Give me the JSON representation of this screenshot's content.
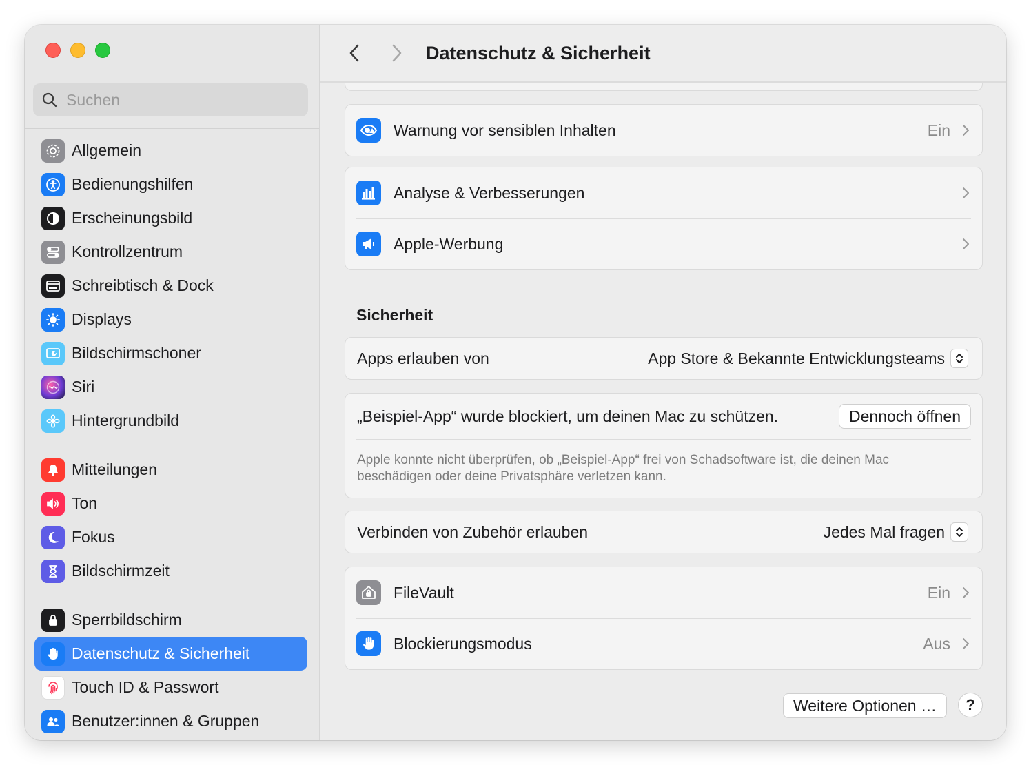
{
  "window": {
    "traffic_lights": [
      "close",
      "minimize",
      "zoom"
    ]
  },
  "search": {
    "placeholder": "Suchen",
    "icon": "magnifying-glass-icon"
  },
  "sidebar": {
    "groups": [
      [
        {
          "label": "Allgemein",
          "icon": "gear-icon",
          "color": "#8e8e93"
        },
        {
          "label": "Bedienungshilfen",
          "icon": "accessibility-icon",
          "color": "#1a7cf5"
        },
        {
          "label": "Erscheinungsbild",
          "icon": "appearance-icon",
          "color": "#1d1d1f"
        },
        {
          "label": "Kontrollzentrum",
          "icon": "control-center-icon",
          "color": "#8e8e93"
        },
        {
          "label": "Schreibtisch & Dock",
          "icon": "dock-icon",
          "color": "#1d1d1f"
        },
        {
          "label": "Displays",
          "icon": "sun-icon",
          "color": "#1a7cf5"
        },
        {
          "label": "Bildschirmschoner",
          "icon": "screensaver-icon",
          "color": "#5ac8fa"
        },
        {
          "label": "Siri",
          "icon": "siri-icon",
          "color": "#6e3cd4"
        },
        {
          "label": "Hintergrundbild",
          "icon": "flower-icon",
          "color": "#5ac8fa"
        }
      ],
      [
        {
          "label": "Mitteilungen",
          "icon": "bell-icon",
          "color": "#ff3b30"
        },
        {
          "label": "Ton",
          "icon": "speaker-icon",
          "color": "#ff2d55"
        },
        {
          "label": "Fokus",
          "icon": "moon-icon",
          "color": "#5e5ce6"
        },
        {
          "label": "Bildschirmzeit",
          "icon": "hourglass-icon",
          "color": "#5e5ce6"
        }
      ],
      [
        {
          "label": "Sperrbildschirm",
          "icon": "lock-icon",
          "color": "#1d1d1f"
        },
        {
          "label": "Datenschutz & Sicherheit",
          "icon": "hand-icon",
          "color": "#1a7cf5",
          "active": true
        },
        {
          "label": "Touch ID & Passwort",
          "icon": "fingerprint-icon",
          "color": "#ffffff"
        },
        {
          "label": "Benutzer:innen & Gruppen",
          "icon": "users-icon",
          "color": "#1a7cf5"
        }
      ]
    ]
  },
  "titlebar": {
    "title": "Datenschutz & Sicherheit"
  },
  "privacy": {
    "sensitive": {
      "label": "Warnung vor sensiblen Inhalten",
      "value": "Ein",
      "icon": "eye-warning-icon"
    },
    "analytics": {
      "label": "Analyse & Verbesserungen",
      "icon": "bar-chart-icon"
    },
    "ads": {
      "label": "Apple-Werbung",
      "icon": "megaphone-icon"
    }
  },
  "security": {
    "title": "Sicherheit",
    "apps_allowed": {
      "label": "Apps erlauben von",
      "value": "App Store & Bekannte Entwicklungsteams"
    },
    "blocked": {
      "message": "„Beispiel-App“ wurde blockiert, um deinen Mac zu schützen.",
      "button": "Dennoch öffnen",
      "note_line1": "Apple konnte nicht überprüfen, ob „Beispiel-App“ frei von Schadsoftware ist, die deinen Mac",
      "note_line2": "beschädigen oder deine Privatsphäre verletzen kann."
    },
    "accessories": {
      "label": "Verbinden von Zubehör erlauben",
      "value": "Jedes Mal fragen"
    },
    "filevault": {
      "label": "FileVault",
      "value": "Ein",
      "icon": "house-lock-icon"
    },
    "lockdown": {
      "label": "Blockierungsmodus",
      "value": "Aus",
      "icon": "hand-icon"
    }
  },
  "footer": {
    "more_options": "Weitere Optionen …",
    "help": "?"
  },
  "colors": {
    "accent": "#3d87f5",
    "sidebar_bg": "#e7e7e7",
    "content_bg": "#ececec"
  }
}
